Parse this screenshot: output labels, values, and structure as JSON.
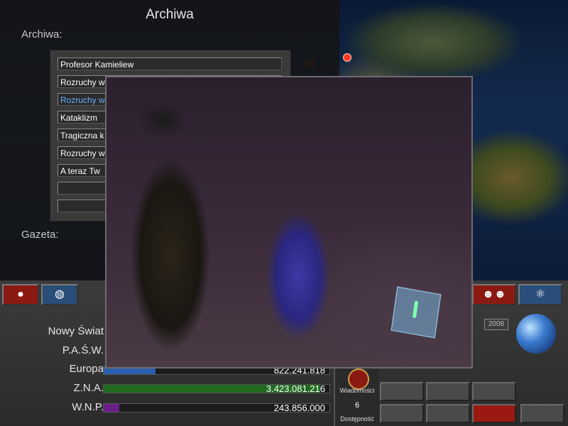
{
  "archive": {
    "title": "Archiwa",
    "section_label": "Archiwa:",
    "gazette_label": "Gazeta:",
    "items": [
      {
        "label": "Profesor Kamieliew"
      },
      {
        "label": "Rozruchy w"
      },
      {
        "label": "Rozruchy w"
      },
      {
        "label": "Kataklizm"
      },
      {
        "label": "Tragiczna k"
      },
      {
        "label": "Rozruchy w"
      },
      {
        "label": "A teraz Tw"
      },
      {
        "label": ""
      },
      {
        "label": ""
      }
    ],
    "selected_index": 2
  },
  "stats": {
    "year": "2008",
    "rows": [
      {
        "label": "Nowy Świat",
        "value": "",
        "color": "#c89b2a",
        "fraction": 0.0
      },
      {
        "label": "P.A.Ś.W.",
        "value": "",
        "color": "#c89b2a",
        "fraction": 0.0
      },
      {
        "label": "Europa",
        "value": "822.241.818",
        "color": "#2a5fb0",
        "fraction": 0.23
      },
      {
        "label": "Z.N.A.",
        "value": "3.423.081.216",
        "color": "#1f6a1f",
        "fraction": 0.96
      },
      {
        "label": "W.N.P.",
        "value": "243.856.000",
        "color": "#6a1f8a",
        "fraction": 0.07
      }
    ]
  },
  "panel": {
    "news_label": "Wiadomości",
    "availability_label": "Dostępność",
    "availability_value": "6"
  },
  "icons": {
    "earth_red": "earth-red-icon",
    "globe": "globe-icon",
    "people": "people-icon",
    "atom": "atom-icon",
    "earth": "earth-icon"
  }
}
